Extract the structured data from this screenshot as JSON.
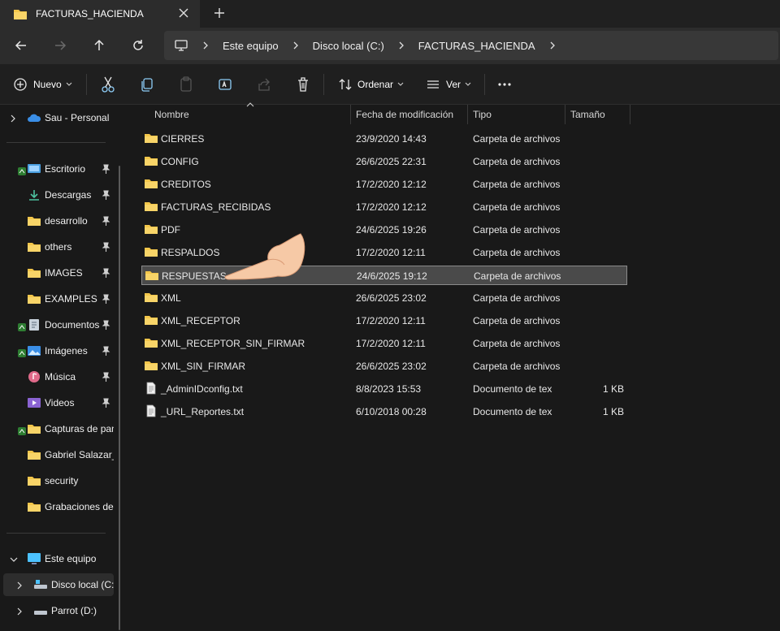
{
  "window": {
    "tab_title": "FACTURAS_HACIENDA"
  },
  "address": {
    "crumbs": [
      "Este equipo",
      "Disco local (C:)",
      "FACTURAS_HACIENDA"
    ]
  },
  "toolbar": {
    "new_label": "Nuevo",
    "sort_label": "Ordenar",
    "view_label": "Ver"
  },
  "sidebar": {
    "cloud": "Sau - Personal",
    "quick": [
      {
        "label": "Escritorio",
        "icon": "desktop-icon"
      },
      {
        "label": "Descargas",
        "icon": "download-icon"
      },
      {
        "label": "desarrollo",
        "icon": "folder-icon"
      },
      {
        "label": "others",
        "icon": "folder-icon"
      },
      {
        "label": "IMAGES",
        "icon": "folder-icon"
      },
      {
        "label": "EXAMPLES",
        "icon": "folder-icon"
      },
      {
        "label": "Documentos",
        "icon": "documents-icon"
      },
      {
        "label": "Imágenes",
        "icon": "pictures-icon"
      },
      {
        "label": "Música",
        "icon": "music-icon"
      },
      {
        "label": "Videos",
        "icon": "videos-icon"
      },
      {
        "label": "Capturas de pan",
        "icon": "folder-icon"
      },
      {
        "label": "Gabriel Salazar_f",
        "icon": "folder-icon"
      },
      {
        "label": "security",
        "icon": "folder-icon"
      },
      {
        "label": "Grabaciones de",
        "icon": "folder-icon"
      }
    ],
    "this_pc": "Este equipo",
    "drives": [
      "Disco local (C:)",
      "Parrot (D:)"
    ]
  },
  "columns": {
    "name": "Nombre",
    "date": "Fecha de modificación",
    "type": "Tipo",
    "size": "Tamaño"
  },
  "files": [
    {
      "name": "CIERRES",
      "date": "23/9/2020 14:43",
      "type": "Carpeta de archivos",
      "size": "",
      "kind": "folder"
    },
    {
      "name": "CONFIG",
      "date": "26/6/2025 22:31",
      "type": "Carpeta de archivos",
      "size": "",
      "kind": "folder"
    },
    {
      "name": "CREDITOS",
      "date": "17/2/2020 12:12",
      "type": "Carpeta de archivos",
      "size": "",
      "kind": "folder"
    },
    {
      "name": "FACTURAS_RECIBIDAS",
      "date": "17/2/2020 12:12",
      "type": "Carpeta de archivos",
      "size": "",
      "kind": "folder"
    },
    {
      "name": "PDF",
      "date": "24/6/2025 19:26",
      "type": "Carpeta de archivos",
      "size": "",
      "kind": "folder"
    },
    {
      "name": "RESPALDOS",
      "date": "17/2/2020 12:11",
      "type": "Carpeta de archivos",
      "size": "",
      "kind": "folder"
    },
    {
      "name": "RESPUESTAS",
      "date": "24/6/2025 19:12",
      "type": "Carpeta de archivos",
      "size": "",
      "kind": "folder",
      "selected": true
    },
    {
      "name": "XML",
      "date": "26/6/2025 23:02",
      "type": "Carpeta de archivos",
      "size": "",
      "kind": "folder"
    },
    {
      "name": "XML_RECEPTOR",
      "date": "17/2/2020 12:11",
      "type": "Carpeta de archivos",
      "size": "",
      "kind": "folder"
    },
    {
      "name": "XML_RECEPTOR_SIN_FIRMAR",
      "date": "17/2/2020 12:11",
      "type": "Carpeta de archivos",
      "size": "",
      "kind": "folder"
    },
    {
      "name": "XML_SIN_FIRMAR",
      "date": "26/6/2025 23:02",
      "type": "Carpeta de archivos",
      "size": "",
      "kind": "folder"
    },
    {
      "name": "_AdminIDconfig.txt",
      "date": "8/8/2023 15:53",
      "type": "Documento de tex",
      "size": "1 KB",
      "kind": "file"
    },
    {
      "name": "_URL_Reportes.txt",
      "date": "6/10/2018 00:28",
      "type": "Documento de tex",
      "size": "1 KB",
      "kind": "file"
    }
  ],
  "colors": {
    "folder": "#f3c64a",
    "selection": "#4a4a4a",
    "accent": "#4cc2ff"
  }
}
